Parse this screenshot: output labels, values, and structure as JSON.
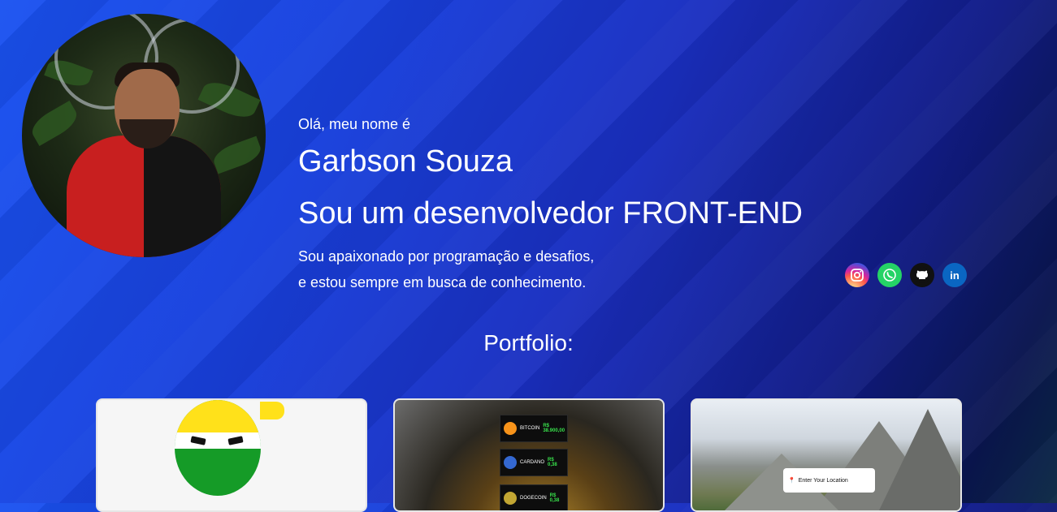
{
  "profile": {
    "avatar_alt": "Garbson Souza photo",
    "intro": "Olá, meu nome é",
    "name": "Garbson Souza",
    "role": "Sou um desenvolvedor FRONT-END",
    "bio_line1": "Sou apaixonado por programação e desafios,",
    "bio_line2": "e estou sempre em busca de conhecimento."
  },
  "socials": [
    {
      "icon": "instagram-icon"
    },
    {
      "icon": "whatsapp-icon"
    },
    {
      "icon": "github-icon"
    },
    {
      "icon": "linkedin-icon",
      "glyph": "in"
    }
  ],
  "portfolio": {
    "title": "Portfolio:",
    "crypto_rows": [
      {
        "name": "BITCOIN",
        "value": "R$ 38.900,00",
        "color": "#f7931a",
        "sym": "B"
      },
      {
        "name": "CARDANO",
        "value": "R$ 0,38",
        "color": "#3468d1",
        "sym": "₳"
      },
      {
        "name": "DOGECOIN",
        "value": "R$ 0,38",
        "color": "#c2a633",
        "sym": "Đ"
      }
    ],
    "weather_placeholder": "Enter Your Location"
  },
  "colors": {
    "background_start": "#1a52f0",
    "background_end": "#0a1550"
  }
}
